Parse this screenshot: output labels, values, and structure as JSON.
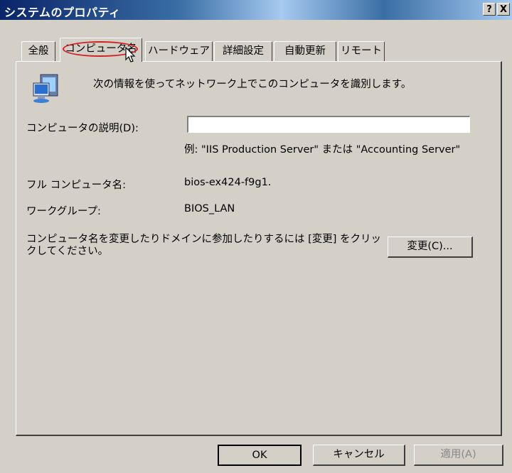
{
  "window": {
    "title": "システムのプロパティ",
    "help_button": "?",
    "close_button": "X"
  },
  "tabs": [
    {
      "label": "全般",
      "active": false
    },
    {
      "label": "コンピュータ名",
      "active": true
    },
    {
      "label": "ハードウェア",
      "active": false
    },
    {
      "label": "詳細設定",
      "active": false
    },
    {
      "label": "自動更新",
      "active": false
    },
    {
      "label": "リモート",
      "active": false
    }
  ],
  "panel": {
    "intro": "次の情報を使ってネットワーク上でこのコンピュータを識別します。",
    "description_label": "コンピュータの説明(D):",
    "description_value": "",
    "example": "例: \"IIS Production Server\" または \"Accounting Server\"",
    "full_name_label": "フル コンピュータ名:",
    "full_name_value": "bios-ex424-f9g1.",
    "workgroup_label": "ワークグループ:",
    "workgroup_value": "BIOS_LAN",
    "rename_text": "コンピュータ名を変更したりドメインに参加したりするには [変更] をクリックしてください。",
    "change_button": "変更(C)..."
  },
  "footer": {
    "ok": "OK",
    "cancel": "キャンセル",
    "apply": "適用(A)"
  },
  "icons": {
    "computer": "computer-icon",
    "cursor": "mouse-cursor-icon"
  }
}
